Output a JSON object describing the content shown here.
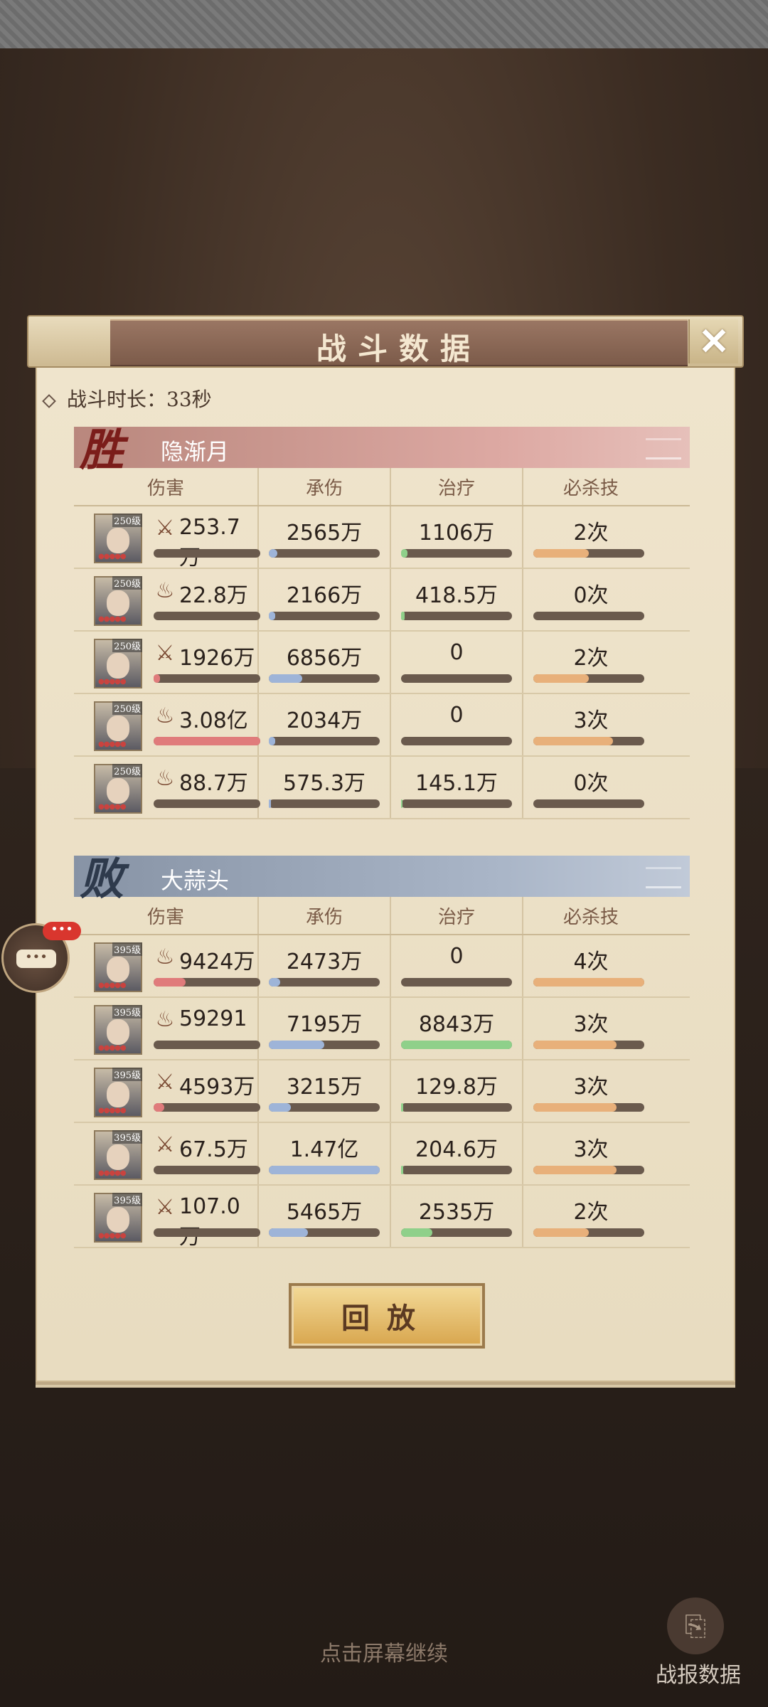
{
  "header": {
    "title": "战斗数据",
    "close_glyph": "✕"
  },
  "battle": {
    "duration_label": "战斗时长：33秒"
  },
  "columns": [
    "伤害",
    "承伤",
    "治疗",
    "必杀技"
  ],
  "winner": {
    "badge": "胜",
    "name": "隐渐月",
    "rows": [
      {
        "level": "250级",
        "icon": "sword-icon",
        "damage": "253.7万",
        "damage_fill": 0.0,
        "taken": "2565万",
        "taken_fill": 0.08,
        "heal": "1106万",
        "heal_fill": 0.06,
        "ult": "2次",
        "ult_fill": 0.5
      },
      {
        "level": "250级",
        "icon": "fire-icon",
        "damage": "22.8万",
        "damage_fill": 0.0,
        "taken": "2166万",
        "taken_fill": 0.06,
        "heal": "418.5万",
        "heal_fill": 0.03,
        "ult": "0次",
        "ult_fill": 0.0
      },
      {
        "level": "250级",
        "icon": "sword-icon",
        "damage": "1926万",
        "damage_fill": 0.06,
        "taken": "6856万",
        "taken_fill": 0.3,
        "heal": "0",
        "heal_fill": 0.0,
        "ult": "2次",
        "ult_fill": 0.5
      },
      {
        "level": "250级",
        "icon": "fire-icon",
        "damage": "3.08亿",
        "damage_fill": 1.0,
        "taken": "2034万",
        "taken_fill": 0.06,
        "heal": "0",
        "heal_fill": 0.0,
        "ult": "3次",
        "ult_fill": 0.72
      },
      {
        "level": "250级",
        "icon": "fire-icon",
        "damage": "88.7万",
        "damage_fill": 0.0,
        "taken": "575.3万",
        "taken_fill": 0.02,
        "heal": "145.1万",
        "heal_fill": 0.01,
        "ult": "0次",
        "ult_fill": 0.0
      }
    ]
  },
  "loser": {
    "badge": "败",
    "name": "大蒜头",
    "rows": [
      {
        "level": "395级",
        "icon": "fire-icon",
        "damage": "9424万",
        "damage_fill": 0.3,
        "taken": "2473万",
        "taken_fill": 0.1,
        "heal": "0",
        "heal_fill": 0.0,
        "ult": "4次",
        "ult_fill": 1.0
      },
      {
        "level": "395级",
        "icon": "fire-icon",
        "damage": "59291",
        "damage_fill": 0.0,
        "taken": "7195万",
        "taken_fill": 0.5,
        "heal": "8843万",
        "heal_fill": 1.0,
        "ult": "3次",
        "ult_fill": 0.75
      },
      {
        "level": "395级",
        "icon": "sword-icon",
        "damage": "4593万",
        "damage_fill": 0.1,
        "taken": "3215万",
        "taken_fill": 0.2,
        "heal": "129.8万",
        "heal_fill": 0.02,
        "ult": "3次",
        "ult_fill": 0.75
      },
      {
        "level": "395级",
        "icon": "sword-icon",
        "damage": "67.5万",
        "damage_fill": 0.0,
        "taken": "1.47亿",
        "taken_fill": 1.0,
        "heal": "204.6万",
        "heal_fill": 0.02,
        "ult": "3次",
        "ult_fill": 0.75
      },
      {
        "level": "395级",
        "icon": "sword-icon",
        "damage": "107.0万",
        "damage_fill": 0.0,
        "taken": "5465万",
        "taken_fill": 0.35,
        "heal": "2535万",
        "heal_fill": 0.28,
        "ult": "2次",
        "ult_fill": 0.5
      }
    ]
  },
  "chat": {
    "badge": "•••",
    "bubble": "•••"
  },
  "replay_label": "回放",
  "footer": {
    "continue_text": "点击屏幕继续",
    "report_label": "战报数据"
  },
  "colors": {
    "damage": "#e07b7b",
    "taken": "#9eb4d8",
    "heal": "#8fd08a",
    "ult": "#e8b07a"
  }
}
